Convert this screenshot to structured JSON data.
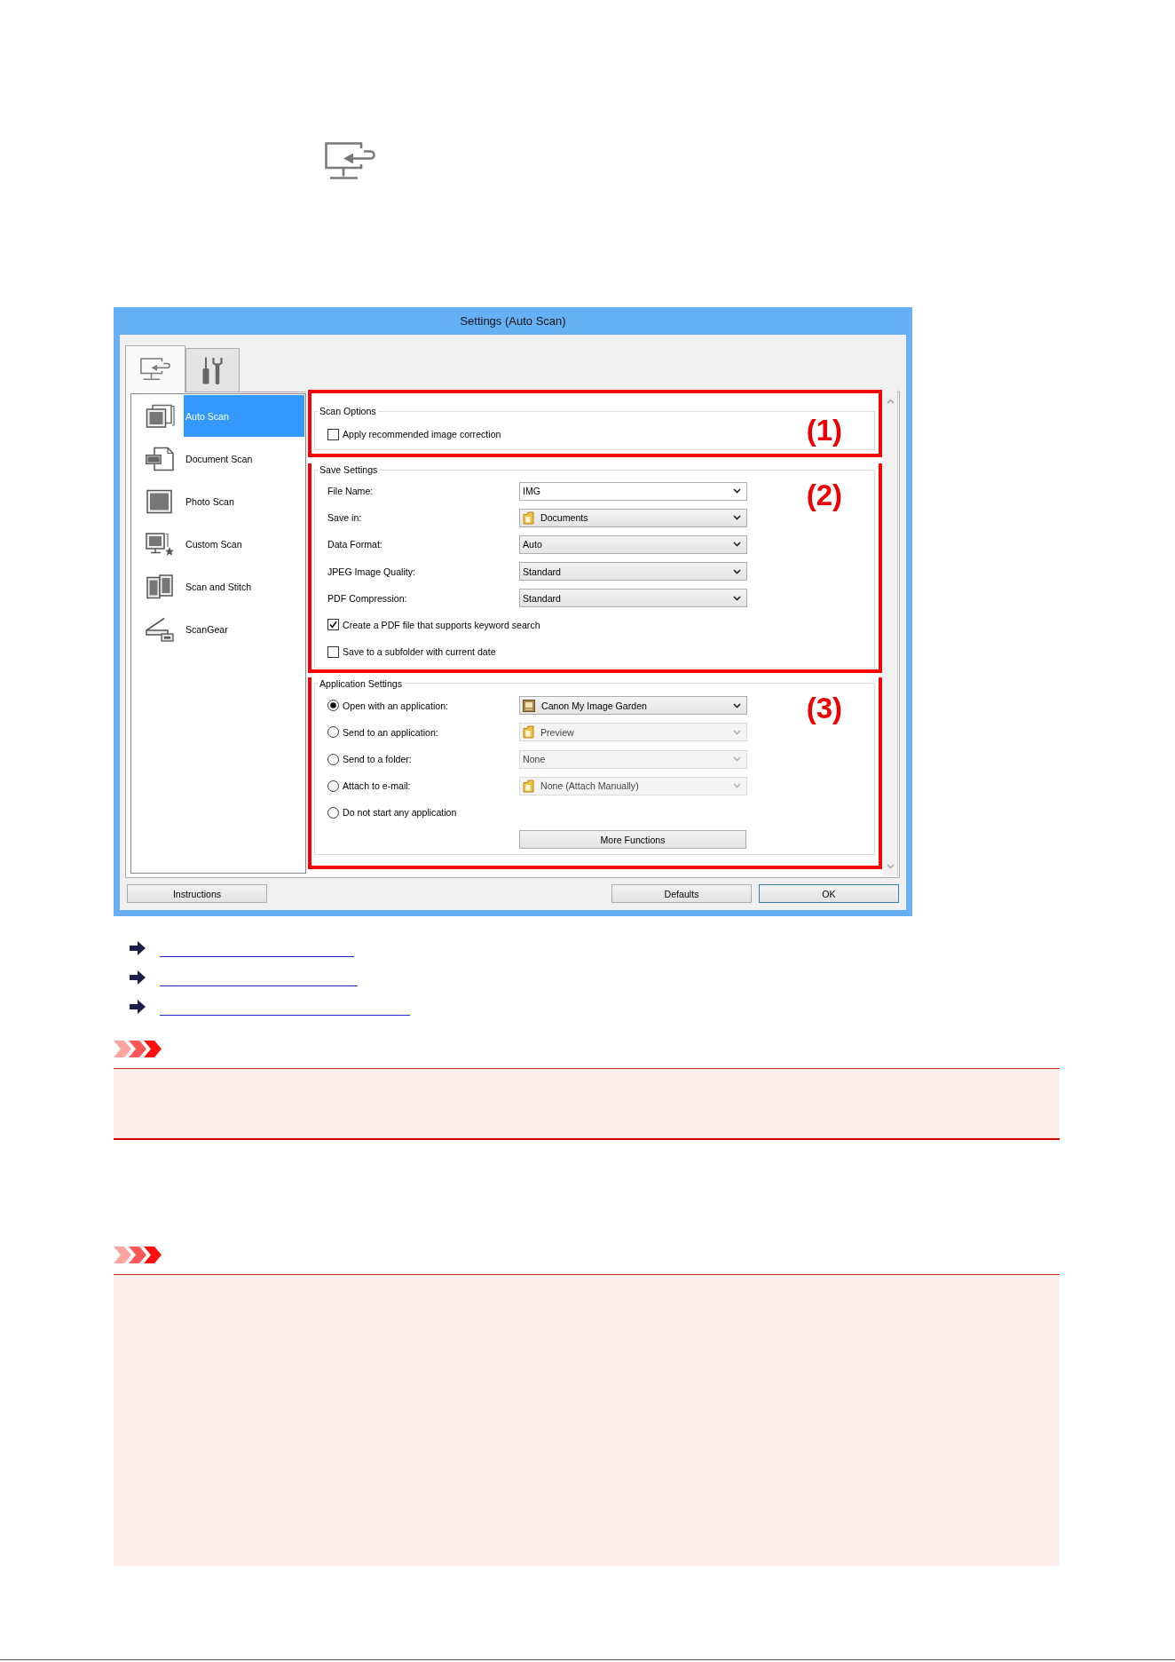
{
  "dialog": {
    "title": "Settings (Auto Scan)",
    "tabs": [
      {
        "selected": true
      },
      {
        "selected": false
      }
    ],
    "scan_types": [
      {
        "label": "Auto Scan",
        "selected": true
      },
      {
        "label": "Document Scan",
        "selected": false
      },
      {
        "label": "Photo Scan",
        "selected": false
      },
      {
        "label": "Custom Scan",
        "selected": false
      },
      {
        "label": "Scan and Stitch",
        "selected": false
      },
      {
        "label": "ScanGear",
        "selected": false
      }
    ],
    "sections": [
      {
        "callout": "(1)",
        "title": "Scan Options",
        "rows": [
          {
            "kind": "checkbox",
            "label": "Apply recommended image correction",
            "checked": false
          }
        ]
      },
      {
        "callout": "(2)",
        "title": "Save Settings",
        "rows": [
          {
            "kind": "dropdown",
            "label": "File Name:",
            "dropdown": {
              "kind": "editable",
              "value": "IMG",
              "disabled": false
            }
          },
          {
            "kind": "dropdown",
            "label": "Save in:",
            "dropdown": {
              "kind": "folder",
              "value": "Documents",
              "disabled": false
            }
          },
          {
            "kind": "dropdown",
            "label": "Data Format:",
            "dropdown": {
              "kind": "plain",
              "value": "Auto",
              "disabled": false
            }
          },
          {
            "kind": "dropdown",
            "label": "JPEG Image Quality:",
            "dropdown": {
              "kind": "plain",
              "value": "Standard",
              "disabled": false
            }
          },
          {
            "kind": "dropdown",
            "label": "PDF Compression:",
            "dropdown": {
              "kind": "plain",
              "value": "Standard",
              "disabled": false
            }
          },
          {
            "kind": "checkbox",
            "label": "Create a PDF file that supports keyword search",
            "checked": true
          },
          {
            "kind": "checkbox",
            "label": "Save to a subfolder with current date",
            "checked": false
          }
        ]
      },
      {
        "callout": "(3)",
        "title": "Application Settings",
        "rows": [
          {
            "kind": "radio_dropdown",
            "label": "Open with an application:",
            "selected": true,
            "dropdown": {
              "kind": "app",
              "value": "Canon My Image Garden",
              "disabled": false
            }
          },
          {
            "kind": "radio_dropdown",
            "label": "Send to an application:",
            "selected": false,
            "dropdown": {
              "kind": "folder",
              "value": "Preview",
              "disabled": true
            }
          },
          {
            "kind": "radio_dropdown",
            "label": "Send to a folder:",
            "selected": false,
            "dropdown": {
              "kind": "plain",
              "value": "None",
              "disabled": true
            }
          },
          {
            "kind": "radio_dropdown",
            "label": "Attach to e-mail:",
            "selected": false,
            "dropdown": {
              "kind": "folder",
              "value": "None (Attach Manually)",
              "disabled": true
            }
          },
          {
            "kind": "radio",
            "label": "Do not start any application",
            "selected": false
          },
          {
            "kind": "button",
            "label": "More Functions"
          }
        ]
      }
    ],
    "footer": {
      "left": [
        {
          "label": "Instructions",
          "default": false
        }
      ],
      "right": [
        {
          "label": "Defaults",
          "default": false
        },
        {
          "label": "OK",
          "default": true
        }
      ]
    }
  },
  "links": [
    {
      "kind": "arrow"
    },
    {
      "kind": "arrow"
    },
    {
      "kind": "arrow"
    }
  ],
  "notes": [
    {
      "kind": "important",
      "cut_off": false
    },
    {
      "kind": "important",
      "cut_off": true
    }
  ]
}
